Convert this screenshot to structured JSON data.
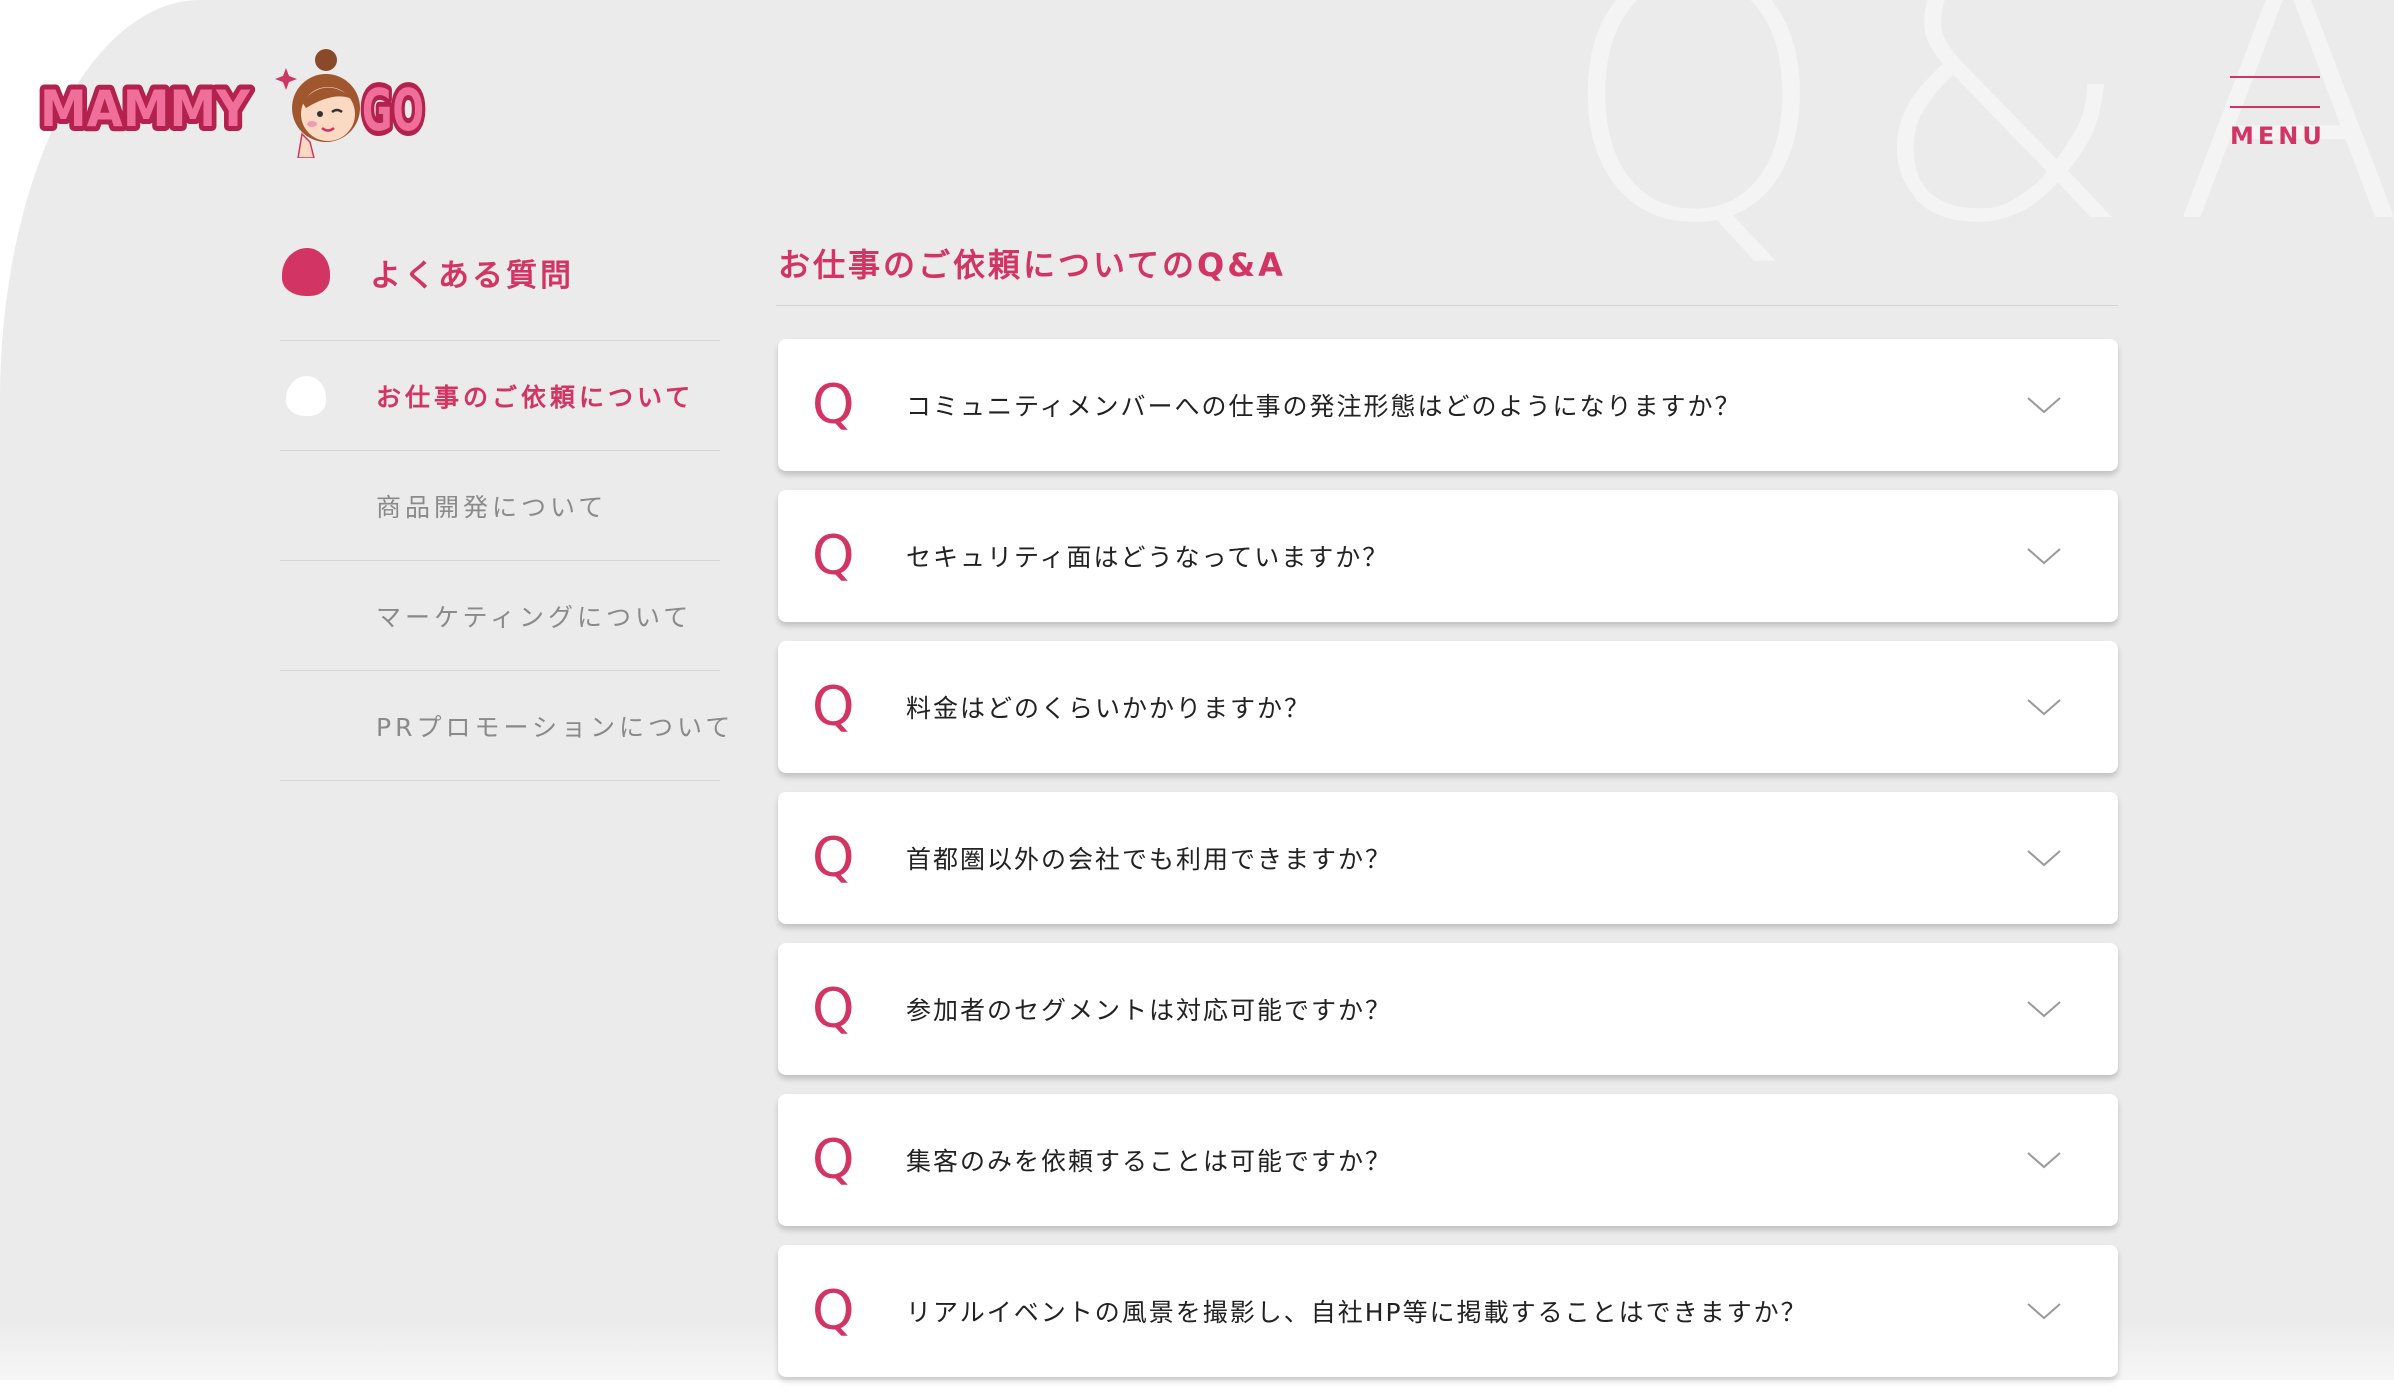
{
  "brand": {
    "logo_text_left": "MAMMY",
    "logo_text_right": "GO",
    "accent_color": "#d23564"
  },
  "watermark": "Q&A",
  "menu": {
    "label": "MENU"
  },
  "sidebar": {
    "title": "よくある質問",
    "items": [
      {
        "label": "お仕事のご依頼について",
        "active": true
      },
      {
        "label": "商品開発について",
        "active": false
      },
      {
        "label": "マーケティングについて",
        "active": false
      },
      {
        "label": "PRプロモーションについて",
        "active": false
      }
    ]
  },
  "section": {
    "title": "お仕事のご依頼についてのQ&A"
  },
  "faq": {
    "marker": "Q",
    "items": [
      {
        "question": "コミュニティメンバーへの仕事の発注形態はどのようになりますか？"
      },
      {
        "question": "セキュリティ面はどうなっていますか？"
      },
      {
        "question": "料金はどのくらいかかりますか？"
      },
      {
        "question": "首都圏以外の会社でも利用できますか？"
      },
      {
        "question": "参加者のセグメントは対応可能ですか？"
      },
      {
        "question": "集客のみを依頼することは可能ですか？"
      },
      {
        "question": "リアルイベントの風景を撮影し、自社HP等に掲載することはできますか？"
      }
    ]
  }
}
